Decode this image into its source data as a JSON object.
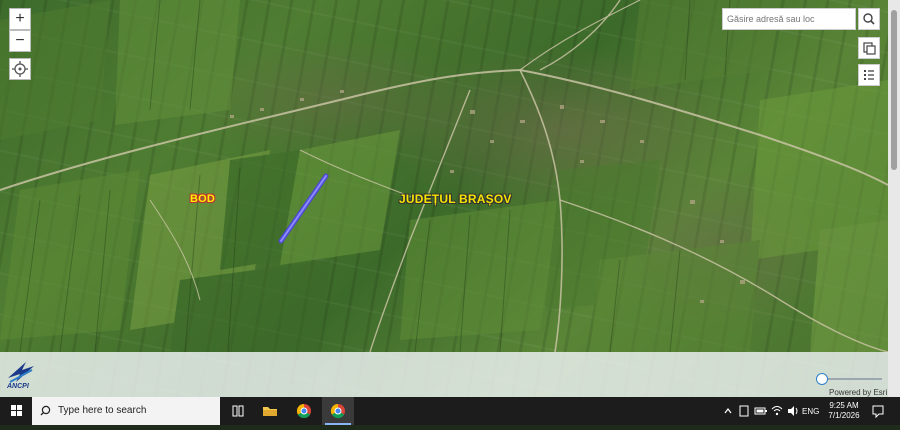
{
  "map": {
    "labels": {
      "locality": "BOD",
      "county": "JUDEȚUL BRAȘOV"
    },
    "controls": {
      "zoom_in": "+",
      "zoom_out": "−"
    },
    "search": {
      "placeholder": "Găsire adresă sau loc"
    },
    "logo_text": "ANCPI",
    "attribution": "Powered by Esri"
  },
  "taskbar": {
    "search_placeholder": "Type here to search",
    "language": "ENG",
    "time": "9:25 AM",
    "date": "7/1/2026"
  },
  "colors": {
    "accent": "#2d7fc8",
    "label_yellow": "#fff200",
    "taskbar": "#1c1c1c"
  }
}
